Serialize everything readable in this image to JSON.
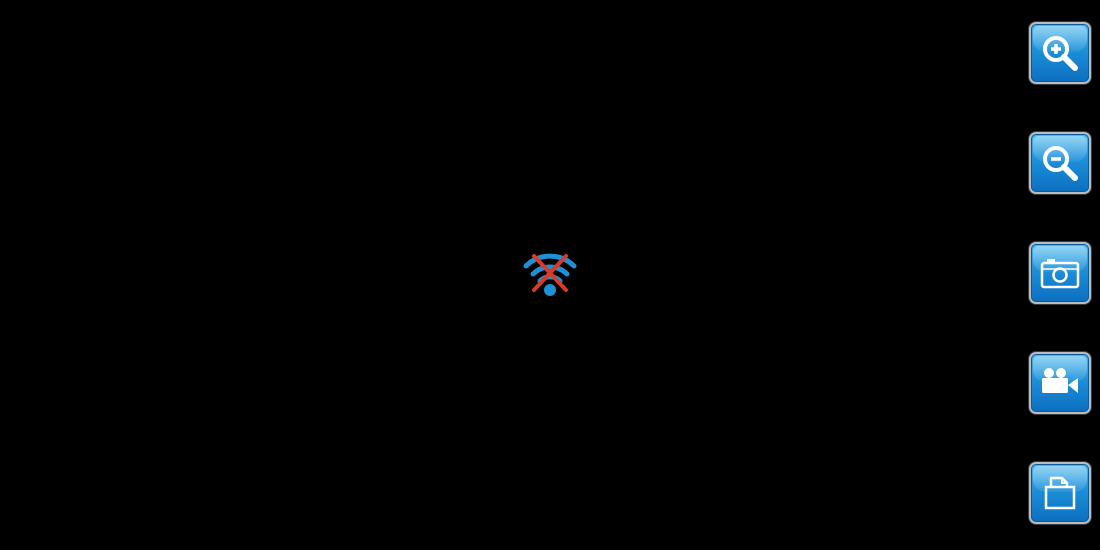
{
  "stream": {
    "status_icon": "wifi-disconnected-icon",
    "colors": {
      "background": "#000000",
      "wifi": "#1f8fd6",
      "cross": "#d93a2a"
    }
  },
  "toolbar": {
    "buttons": [
      {
        "icon": "zoom-in-icon"
      },
      {
        "icon": "zoom-out-icon"
      },
      {
        "icon": "camera-icon"
      },
      {
        "icon": "video-camera-icon"
      },
      {
        "icon": "folder-icon"
      }
    ],
    "colors": {
      "button_top": "#45b8ef",
      "button_bottom": "#0c6fc0",
      "button_border": "#b9bcc0",
      "icon": "#ffffff"
    }
  }
}
